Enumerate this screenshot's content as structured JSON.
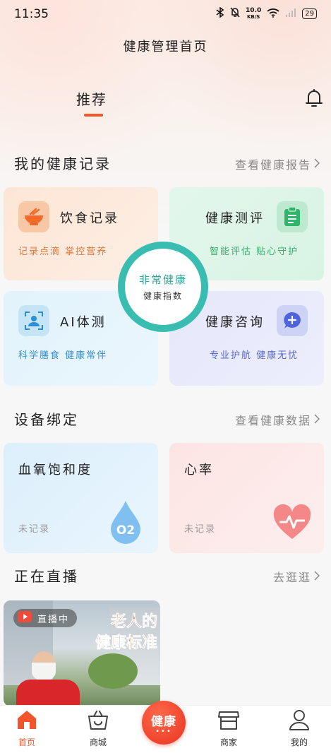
{
  "status_bar": {
    "time": "11:35",
    "net_speed": "10.0",
    "net_unit": "KB/S",
    "battery": "29"
  },
  "header": {
    "title": "健康管理首页"
  },
  "tabs": {
    "recommended": "推荐"
  },
  "health_records": {
    "title": "我的健康记录",
    "link": "查看健康报告",
    "cards": [
      {
        "title": "饮食记录",
        "subtitle": "记录点滴 掌控营养"
      },
      {
        "title": "健康测评",
        "subtitle": "智能评估 贴心守护"
      },
      {
        "title": "AI体测",
        "subtitle": "科学膳食 健康常伴"
      },
      {
        "title": "健康咨询",
        "subtitle": "专业护航 健康无忧"
      }
    ],
    "center": {
      "title": "非常健康",
      "subtitle": "健康指数"
    }
  },
  "devices": {
    "title": "设备绑定",
    "link": "查看健康数据",
    "cards": [
      {
        "title": "血氧饱和度",
        "status": "未记录",
        "badge": "O2"
      },
      {
        "title": "心率",
        "status": "未记录"
      }
    ]
  },
  "live": {
    "title": "正在直播",
    "link": "去逛逛",
    "badge": "直播中",
    "headline_1": "老人的",
    "headline_2": "健康标准"
  },
  "tabbar": {
    "home": "首页",
    "mall": "商城",
    "center": "健康",
    "merchant": "商家",
    "me": "我的"
  },
  "colors": {
    "accent": "#f05a28",
    "teal": "#39bdb0"
  }
}
